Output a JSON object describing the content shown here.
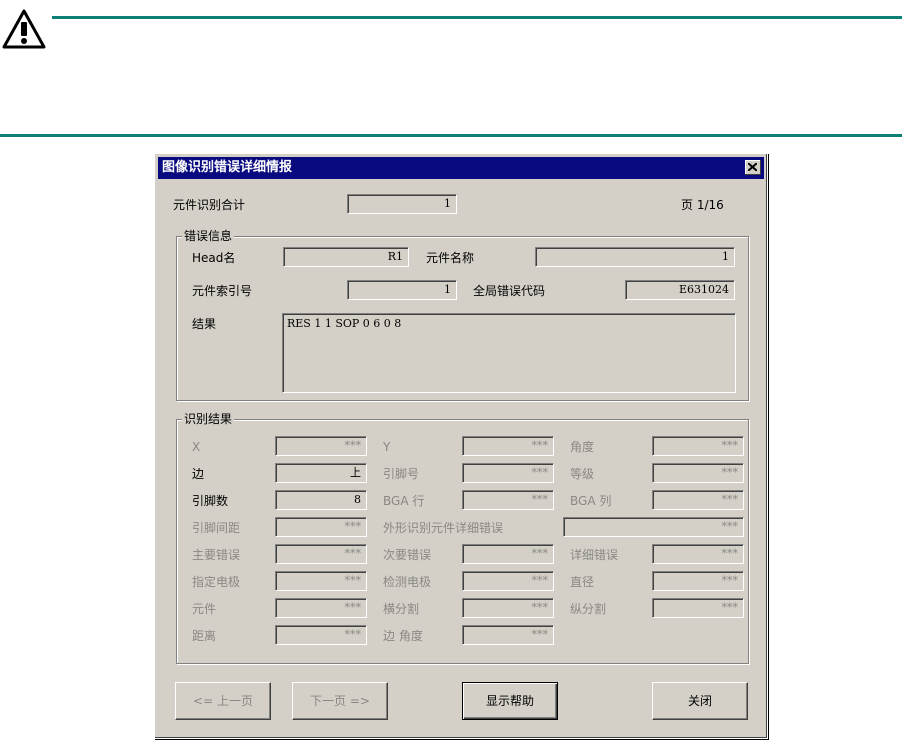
{
  "dialog": {
    "title": "图像识别错误详细情报",
    "colors": {
      "titlebar": "#0a0a80",
      "face": "#d4d0c8",
      "rule": "#0d7f76"
    },
    "summary": {
      "count_label": "元件识别合计",
      "count_value": "1",
      "page_label": "页 1/16"
    },
    "error_info": {
      "title": "错误信息",
      "head_label": "Head名",
      "head_value": "R1",
      "part_name_label": "元件名称",
      "part_name_value": "1",
      "index_label": "元件索引号",
      "index_value": "1",
      "global_code_label": "全局错误代码",
      "global_code_value": "E631024",
      "result_label": "结果",
      "result_value": "RES 1 1 SOP 0 6 0 8"
    },
    "recog": {
      "title": "识别结果",
      "rows": [
        {
          "l1": "X",
          "v1": "***",
          "l2": "Y",
          "v2": "***",
          "l3": "角度",
          "v3": "***"
        },
        {
          "l1": "边",
          "v1": "上",
          "l2": "引脚号",
          "v2": "***",
          "l3": "等级",
          "v3": "***"
        },
        {
          "l1": "引脚数",
          "v1": "8",
          "l2": "BGA 行",
          "v2": "***",
          "l3": "BGA 列",
          "v3": "***"
        },
        {
          "l1": "引脚间距",
          "v1": "***",
          "l2": "外形识别元件详细错误",
          "v2": "***"
        },
        {
          "l1": "主要错误",
          "v1": "***",
          "l2": "次要错误",
          "v2": "***",
          "l3": "详细错误",
          "v3": "***"
        },
        {
          "l1": "指定电极",
          "v1": "***",
          "l2": "检测电极",
          "v2": "***",
          "l3": "直径",
          "v3": "***"
        },
        {
          "l1": "元件",
          "v1": "***",
          "l2": "横分割",
          "v2": "***",
          "l3": "纵分割",
          "v3": "***"
        },
        {
          "l1": "距离",
          "v1": "***",
          "l2": "边 角度",
          "v2": "***"
        }
      ]
    },
    "buttons": {
      "prev": "<= 上一页",
      "next": "下一页 =>",
      "help": "显示帮助",
      "close": "关闭"
    }
  },
  "icons": {
    "warning": "warning-icon",
    "close": "close-icon"
  }
}
